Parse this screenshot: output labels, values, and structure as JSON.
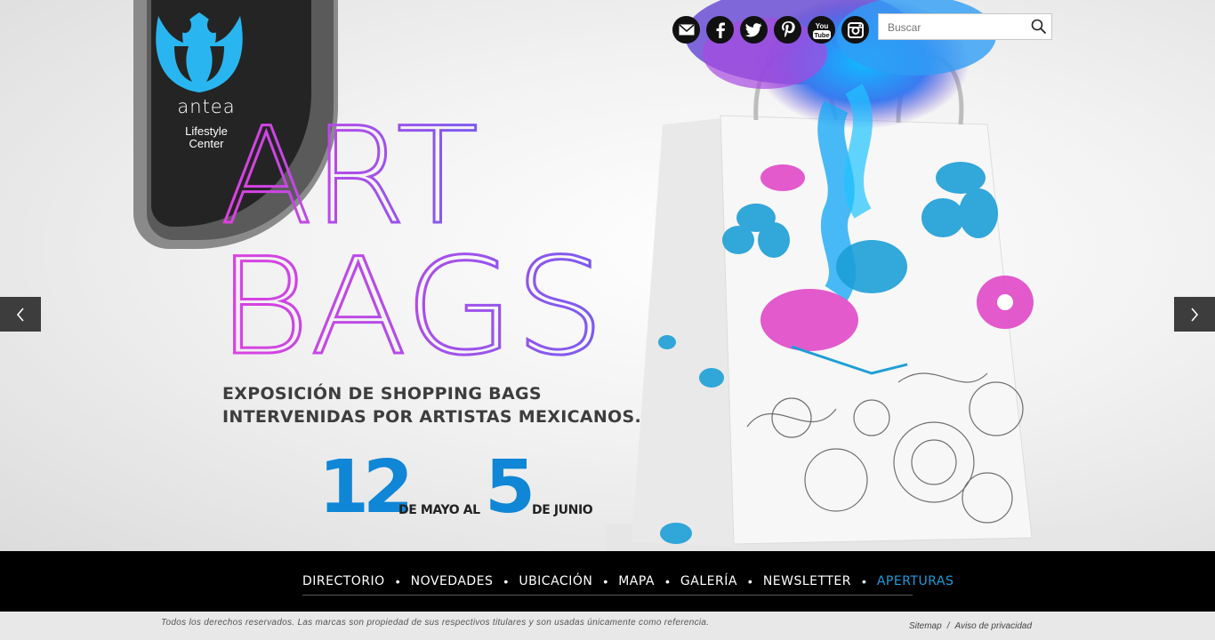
{
  "brand": {
    "name": "antea",
    "tagline_line1": "Lifestyle",
    "tagline_line2": "Center"
  },
  "hero": {
    "title_line1": "ART",
    "title_line2": "BAGS",
    "description_line1": "EXPOSICIÓN DE SHOPPING BAGS",
    "description_line2": "INTERVENIDAS POR ARTISTAS MEXICANOS.",
    "date_start_day": "12",
    "date_start_text": "DE MAYO AL",
    "date_end_day": "5",
    "date_end_text": "DE JUNIO"
  },
  "social": [
    {
      "name": "email-icon"
    },
    {
      "name": "facebook-icon"
    },
    {
      "name": "twitter-icon"
    },
    {
      "name": "pinterest-icon"
    },
    {
      "name": "youtube-icon",
      "label_top": "You",
      "label_bottom": "Tube"
    },
    {
      "name": "instagram-icon"
    }
  ],
  "search": {
    "placeholder": "Buscar"
  },
  "nav": [
    {
      "label": "DIRECTORIO",
      "active": false
    },
    {
      "label": "NOVEDADES",
      "active": false
    },
    {
      "label": "UBICACIÓN",
      "active": false
    },
    {
      "label": "MAPA",
      "active": false
    },
    {
      "label": "GALERÍA",
      "active": false
    },
    {
      "label": "NEWSLETTER",
      "active": false
    },
    {
      "label": "APERTURAS",
      "active": true
    }
  ],
  "footer": {
    "copyright": "Todos los derechos reservados. Las marcas son propiedad de sus respectivos titulares y son usadas únicamente como referencia.",
    "sitemap": "Sitemap",
    "separator": "/",
    "privacy": "Aviso de privacidad"
  },
  "colors": {
    "accent_blue": "#1e9bdc",
    "date_blue": "#0f86d6",
    "logo_blue": "#29b6f0",
    "title_magenta": "#e040e0",
    "title_violet": "#7a5cf0"
  }
}
